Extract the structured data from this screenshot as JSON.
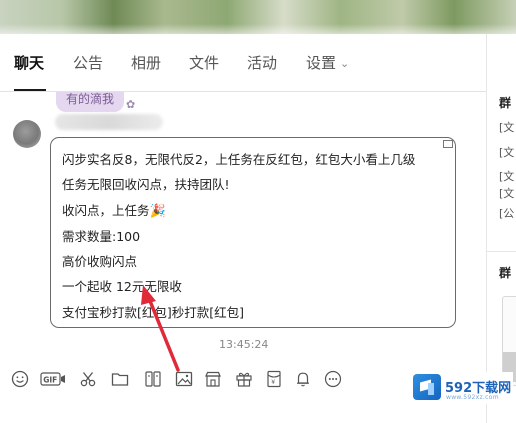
{
  "tabs": [
    {
      "label": "聊天",
      "active": true
    },
    {
      "label": "公告"
    },
    {
      "label": "相册"
    },
    {
      "label": "文件"
    },
    {
      "label": "活动"
    },
    {
      "label": "设置"
    }
  ],
  "previous_message": {
    "text": "有的滴我"
  },
  "message": {
    "lines": [
      "闪步实名反8，无限代反2，上任务在反红包，红包大小看上几级",
      "任务无限回收闪点，扶持团队!",
      "收闪点，上任务",
      "需求数量:100",
      "高价收购闪点",
      "一个起收  12元无限收",
      "支付宝秒打款[红包]秒打款[红包]"
    ],
    "party_emoji": "🎉",
    "timestamp": "13:45:24"
  },
  "toolbar": {
    "icons": [
      "emoji-icon",
      "gif-icon",
      "scissors-icon",
      "folder-icon",
      "sticker-icon",
      "image-icon",
      "shop-icon",
      "gift-icon",
      "red-packet-icon",
      "bell-icon",
      "more-icon"
    ],
    "gif_label": "GIF"
  },
  "right_panel": {
    "title": "群",
    "items": [
      "[文",
      "[文",
      "[文",
      "[文",
      "[公"
    ],
    "title2": "群"
  },
  "watermark": {
    "brand": "592下载网",
    "sub": "www.592xz.com"
  },
  "colors": {
    "arrow": "#e02a3a",
    "bubble_border": "#6b6b6b",
    "prev_bubble": "#e4d7ef"
  }
}
